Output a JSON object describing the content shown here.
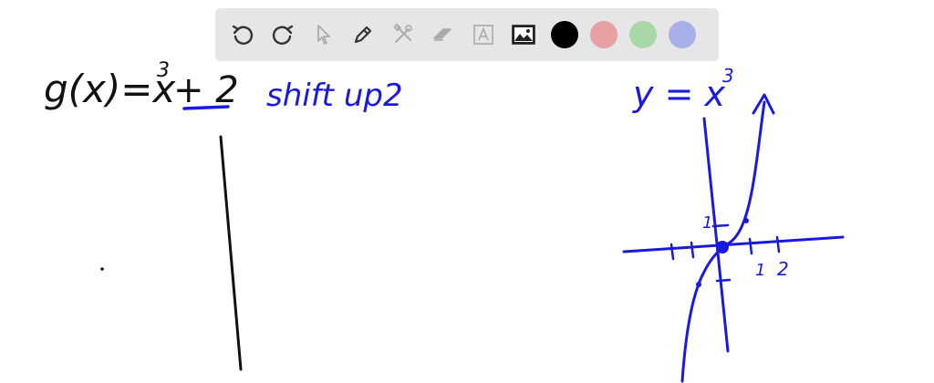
{
  "toolbar": {
    "tools": [
      {
        "name": "undo-icon"
      },
      {
        "name": "redo-icon"
      },
      {
        "name": "select-pointer-icon"
      },
      {
        "name": "pen-icon"
      },
      {
        "name": "tools-icon"
      },
      {
        "name": "eraser-icon"
      },
      {
        "name": "text-box-icon"
      },
      {
        "name": "image-icon"
      }
    ],
    "colors": {
      "black": "#000000",
      "red": "#e8a0a4",
      "green": "#a8d8a8",
      "blue": "#a8b0e8"
    }
  },
  "notes": {
    "equation_left": "g(x)=x",
    "equation_exp": "3",
    "equation_right": "+ 2",
    "annotation": "shift up2",
    "graph_label": "y = x",
    "graph_label_exp": "3",
    "tick_1_y": "1",
    "tick_1_x": "1",
    "tick_2_x": "2"
  },
  "ink_colors": {
    "black": "#111111",
    "blue": "#1a1adf"
  }
}
